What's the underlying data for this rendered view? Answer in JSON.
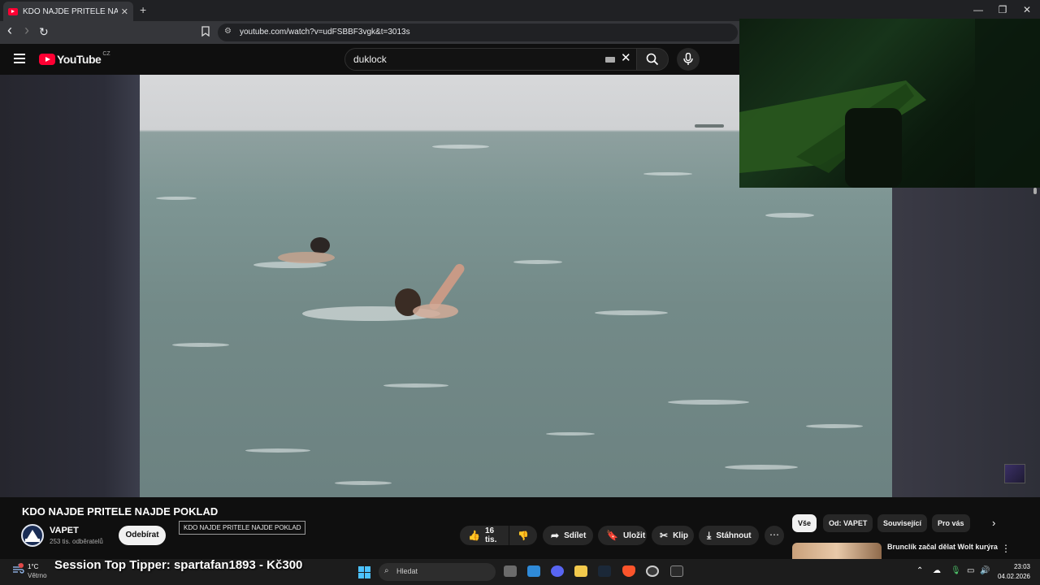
{
  "browser": {
    "tab_title": "KDO NAJDE PRITELE NAJDE P",
    "tab_close": "✕",
    "new_tab": "+",
    "url": "youtube.com/watch?v=udFSBBF3vgk&t=3013s",
    "window_controls": {
      "minimize": "—",
      "maximize": "❐",
      "close": "✕"
    },
    "nav": {
      "back": "‹",
      "forward": "›",
      "reload": "↻"
    }
  },
  "youtube": {
    "logo_text": "YouTube",
    "country_code": "CZ",
    "search_value": "duklock",
    "clear_icon": "✕"
  },
  "video": {
    "title": "KDO NAJDE PRITELE NAJDE POKLAD",
    "tooltip": "KDO NAJDE PRITELE NAJDE POKLAD"
  },
  "channel": {
    "name": "VAPET",
    "subscribers": "253 tis. odběratelů",
    "subscribe_label": "Odebírat"
  },
  "actions": {
    "likes": "16 tis.",
    "share": "Sdílet",
    "save": "Uložit",
    "clip": "Klip",
    "download": "Stáhnout",
    "more": "⋯"
  },
  "chips": [
    "Vše",
    "Od: VAPET",
    "Související",
    "Pro vás"
  ],
  "recommendation": {
    "title": "Brunclík začal dělat Wolt kurýra"
  },
  "taskbar": {
    "temperature": "1°C",
    "weather_desc": "Větrno",
    "overlay_text": "Session Top Tipper: spartafan1893 - Kč300",
    "search_placeholder": "Hledat",
    "time": "23:03",
    "date": "04.02.2026"
  },
  "colors": {
    "youtube_red": "#ff0033",
    "background": "#0f0f0f",
    "pill_bg": "#272727"
  }
}
